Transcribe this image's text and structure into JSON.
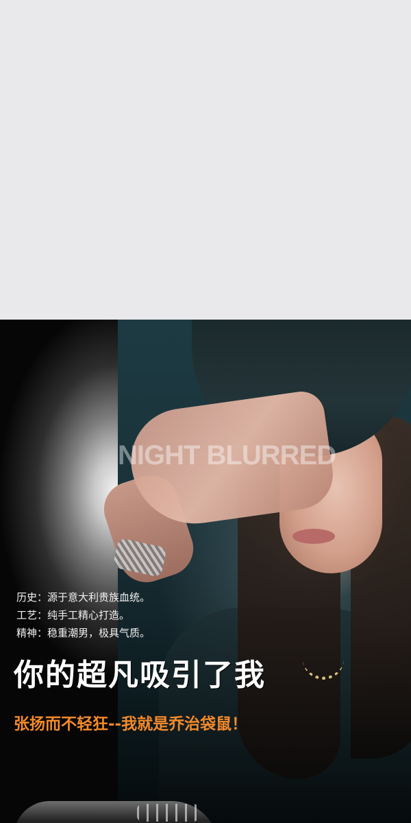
{
  "banner": {
    "watermark": "NIGHT BLURRED",
    "info": [
      "历史：源于意大利贵族血统。",
      "工艺：纯手工精心打造。",
      "精神：稳重潮男，极具气质。"
    ],
    "headline": "你的超凡吸引了我",
    "subline": "张扬而不轻狂--我就是乔治袋鼠！",
    "colors": {
      "headline": "#ffffff",
      "subline": "#f48a2a",
      "background_top": "#e9e9eb",
      "banner_bg": "#020405"
    }
  }
}
